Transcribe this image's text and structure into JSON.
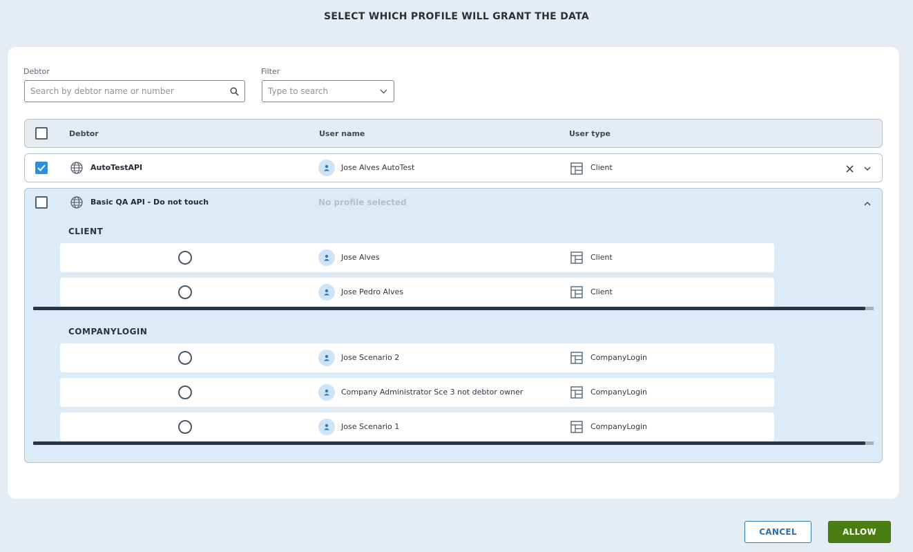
{
  "page": {
    "title": "SELECT WHICH PROFILE WILL GRANT THE DATA"
  },
  "filters": {
    "debtor_label": "Debtor",
    "debtor_placeholder": "Search by debtor name or number",
    "filter_label": "Filter",
    "filter_placeholder": "Type to search"
  },
  "table": {
    "headers": {
      "debtor": "Debtor",
      "user_name": "User name",
      "user_type": "User type"
    },
    "rows": [
      {
        "debtor": "AutoTestAPI",
        "user_name": "Jose Alves AutoTest",
        "user_type": "Client",
        "checked": true
      },
      {
        "debtor": "Basic QA API - Do not touch",
        "user_name": "No profile selected",
        "checked": false,
        "groups": [
          {
            "title": "CLIENT",
            "items": [
              {
                "user_name": "Jose Alves",
                "user_type": "Client"
              },
              {
                "user_name": "Jose Pedro Alves",
                "user_type": "Client"
              }
            ]
          },
          {
            "title": "COMPANYLOGIN",
            "items": [
              {
                "user_name": "Jose Scenario 2",
                "user_type": "CompanyLogin"
              },
              {
                "user_name": "Company Administrator Sce 3 not debtor owner",
                "user_type": "CompanyLogin"
              },
              {
                "user_name": "Jose Scenario 1",
                "user_type": "CompanyLogin"
              }
            ]
          }
        ]
      }
    ]
  },
  "actions": {
    "cancel": "CANCEL",
    "allow": "ALLOW"
  },
  "colors": {
    "accent": "#2d8fdc",
    "allow": "#4a7d12",
    "expanded_bg": "#dcebf8"
  }
}
